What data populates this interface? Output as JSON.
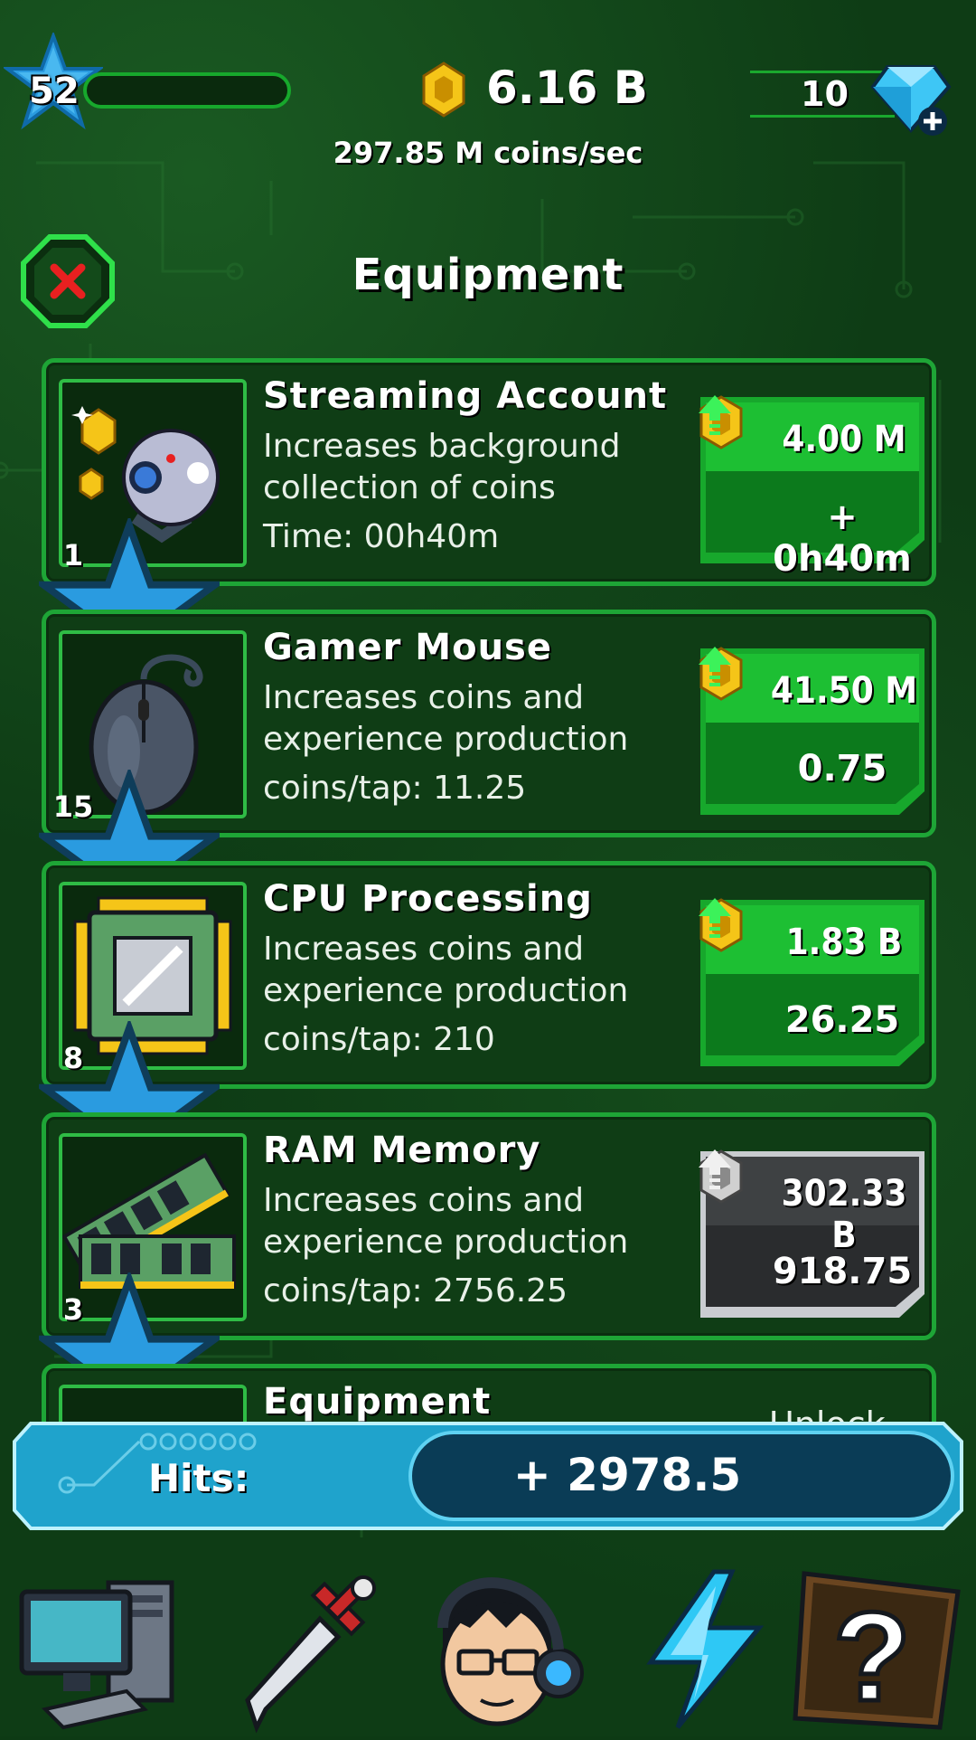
{
  "hud": {
    "level": "52",
    "coins_total": "6.16 B",
    "coins_rate": "297.85 M coins/sec",
    "gems": "10"
  },
  "header": {
    "title": "Equipment"
  },
  "items": [
    {
      "name": "Streaming Account",
      "desc": "Increases background collection of coins",
      "stat": "Time: 00h40m",
      "level": "1",
      "price": "4.00 M",
      "gain": "+ 0h40m",
      "affordable": true
    },
    {
      "name": "Gamer Mouse",
      "desc": "Increases coins and experience production",
      "stat": "coins/tap: 11.25",
      "level": "15",
      "price": "41.50 M",
      "gain": "0.75",
      "affordable": true
    },
    {
      "name": "CPU Processing",
      "desc": "Increases coins and experience production",
      "stat": "coins/tap: 210",
      "level": "8",
      "price": "1.83 B",
      "gain": "26.25",
      "affordable": true
    },
    {
      "name": "RAM Memory",
      "desc": "Increases coins and experience production",
      "stat": "coins/tap: 2756.25",
      "level": "3",
      "price": "302.33 B",
      "gain": "918.75",
      "affordable": false
    },
    {
      "name": "Equipment",
      "unlock_label": "Unlock"
    }
  ],
  "hits": {
    "label": "Hits:",
    "value": "+ 2978.5"
  },
  "nav": [
    "computer-icon",
    "sword-icon",
    "gamer-avatar-icon",
    "lightning-icon",
    "mystery-box-icon"
  ],
  "colors": {
    "accent_green": "#1ea536",
    "button_green": "#17a82c",
    "button_gray": "#3a3a3a",
    "coin_gold": "#f5c518",
    "hits_blue": "#1fa3cc"
  }
}
